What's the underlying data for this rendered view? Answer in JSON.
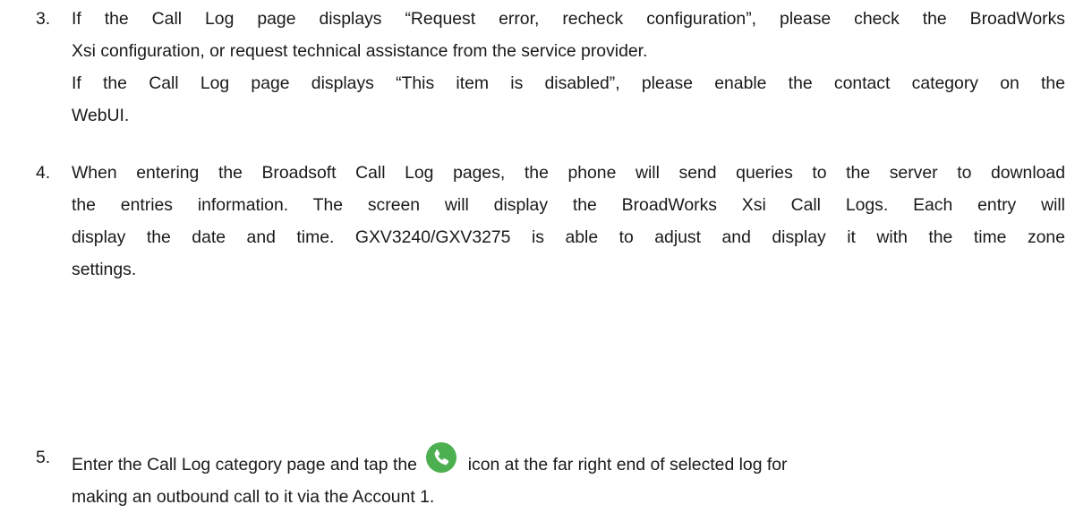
{
  "items": [
    {
      "number": "3.",
      "paragraphs": [
        [
          "If the Call Log page displays “Request error, recheck configuration”, please check the BroadWorks",
          "Xsi configuration, or request technical assistance from the service provider."
        ],
        [
          "If the Call Log page displays “This item is disabled”, please enable the contact category on the",
          "WebUI."
        ]
      ]
    },
    {
      "number": "4.",
      "lines": [
        "When entering the Broadsoft Call Log pages, the phone will send queries to the server to download",
        "the entries information. The screen will display the BroadWorks Xsi Call Logs. Each entry will",
        "display the date and time. GXV3240/GXV3275 is able to adjust and display it with the time zone",
        "settings."
      ]
    },
    {
      "number": "5.",
      "before_icon": "Enter the Call Log category page and tap the",
      "icon": "phone-call-icon",
      "icon_color": "#4cb050",
      "after_icon": "icon at the far right end of selected log for",
      "last_line": "making an outbound call to it via the Account 1."
    }
  ]
}
